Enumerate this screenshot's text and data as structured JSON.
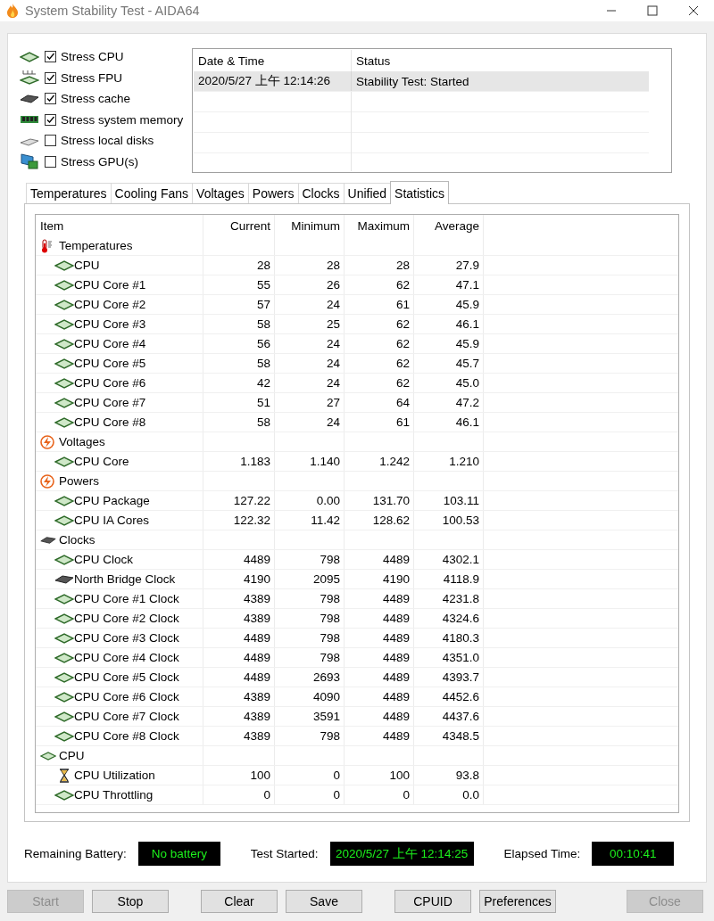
{
  "window": {
    "title": "System Stability Test - AIDA64"
  },
  "stress_options": [
    {
      "label": "Stress CPU",
      "checked": true,
      "kind": "cpu"
    },
    {
      "label": "Stress FPU",
      "checked": true,
      "kind": "fpu"
    },
    {
      "label": "Stress cache",
      "checked": true,
      "kind": "cache"
    },
    {
      "label": "Stress system memory",
      "checked": true,
      "kind": "memory"
    },
    {
      "label": "Stress local disks",
      "checked": false,
      "kind": "disk"
    },
    {
      "label": "Stress GPU(s)",
      "checked": false,
      "kind": "gpu"
    }
  ],
  "log": {
    "columns": [
      "Date & Time",
      "Status"
    ],
    "rows": [
      {
        "date_time": "2020/5/27 上午 12:14:26",
        "status": "Stability Test: Started",
        "selected": true
      }
    ]
  },
  "tabs": [
    {
      "label": "Temperatures",
      "selected": false
    },
    {
      "label": "Cooling Fans",
      "selected": false
    },
    {
      "label": "Voltages",
      "selected": false
    },
    {
      "label": "Powers",
      "selected": false
    },
    {
      "label": "Clocks",
      "selected": false
    },
    {
      "label": "Unified",
      "selected": false
    },
    {
      "label": "Statistics",
      "selected": true
    }
  ],
  "statistics": {
    "columns": [
      "Item",
      "Current",
      "Minimum",
      "Maximum",
      "Average"
    ],
    "groups": [
      {
        "label": "Temperatures",
        "kind": "thermometer",
        "children": [
          {
            "label": "CPU",
            "kind": "cpu",
            "values": [
              "28",
              "28",
              "28",
              "27.9"
            ]
          },
          {
            "label": "CPU Core #1",
            "kind": "cpu",
            "values": [
              "55",
              "26",
              "62",
              "47.1"
            ]
          },
          {
            "label": "CPU Core #2",
            "kind": "cpu",
            "values": [
              "57",
              "24",
              "61",
              "45.9"
            ]
          },
          {
            "label": "CPU Core #3",
            "kind": "cpu",
            "values": [
              "58",
              "25",
              "62",
              "46.1"
            ]
          },
          {
            "label": "CPU Core #4",
            "kind": "cpu",
            "values": [
              "56",
              "24",
              "62",
              "45.9"
            ]
          },
          {
            "label": "CPU Core #5",
            "kind": "cpu",
            "values": [
              "58",
              "24",
              "62",
              "45.7"
            ]
          },
          {
            "label": "CPU Core #6",
            "kind": "cpu",
            "values": [
              "42",
              "24",
              "62",
              "45.0"
            ]
          },
          {
            "label": "CPU Core #7",
            "kind": "cpu",
            "values": [
              "51",
              "27",
              "64",
              "47.2"
            ]
          },
          {
            "label": "CPU Core #8",
            "kind": "cpu",
            "values": [
              "58",
              "24",
              "61",
              "46.1"
            ]
          }
        ]
      },
      {
        "label": "Voltages",
        "kind": "bolt",
        "children": [
          {
            "label": "CPU Core",
            "kind": "cpu",
            "values": [
              "1.183",
              "1.140",
              "1.242",
              "1.210"
            ]
          }
        ]
      },
      {
        "label": "Powers",
        "kind": "bolt",
        "children": [
          {
            "label": "CPU Package",
            "kind": "cpu",
            "values": [
              "127.22",
              "0.00",
              "131.70",
              "103.11"
            ]
          },
          {
            "label": "CPU IA Cores",
            "kind": "cpu",
            "values": [
              "122.32",
              "11.42",
              "128.62",
              "100.53"
            ]
          }
        ]
      },
      {
        "label": "Clocks",
        "kind": "chip",
        "children": [
          {
            "label": "CPU Clock",
            "kind": "cpu",
            "values": [
              "4489",
              "798",
              "4489",
              "4302.1"
            ]
          },
          {
            "label": "North Bridge Clock",
            "kind": "chip",
            "values": [
              "4190",
              "2095",
              "4190",
              "4118.9"
            ]
          },
          {
            "label": "CPU Core #1 Clock",
            "kind": "cpu",
            "values": [
              "4389",
              "798",
              "4489",
              "4231.8"
            ]
          },
          {
            "label": "CPU Core #2 Clock",
            "kind": "cpu",
            "values": [
              "4389",
              "798",
              "4489",
              "4324.6"
            ]
          },
          {
            "label": "CPU Core #3 Clock",
            "kind": "cpu",
            "values": [
              "4489",
              "798",
              "4489",
              "4180.3"
            ]
          },
          {
            "label": "CPU Core #4 Clock",
            "kind": "cpu",
            "values": [
              "4489",
              "798",
              "4489",
              "4351.0"
            ]
          },
          {
            "label": "CPU Core #5 Clock",
            "kind": "cpu",
            "values": [
              "4489",
              "2693",
              "4489",
              "4393.7"
            ]
          },
          {
            "label": "CPU Core #6 Clock",
            "kind": "cpu",
            "values": [
              "4389",
              "4090",
              "4489",
              "4452.6"
            ]
          },
          {
            "label": "CPU Core #7 Clock",
            "kind": "cpu",
            "values": [
              "4389",
              "3591",
              "4489",
              "4437.6"
            ]
          },
          {
            "label": "CPU Core #8 Clock",
            "kind": "cpu",
            "values": [
              "4389",
              "798",
              "4489",
              "4348.5"
            ]
          }
        ]
      },
      {
        "label": "CPU",
        "kind": "cpu",
        "children": [
          {
            "label": "CPU Utilization",
            "kind": "hourglass",
            "values": [
              "100",
              "0",
              "100",
              "93.8"
            ]
          },
          {
            "label": "CPU Throttling",
            "kind": "cpu",
            "values": [
              "0",
              "0",
              "0",
              "0.0"
            ]
          }
        ]
      }
    ]
  },
  "status": [
    {
      "label": "Remaining Battery:",
      "value": "No battery"
    },
    {
      "label": "Test Started:",
      "value": "2020/5/27 上午 12:14:25"
    },
    {
      "label": "Elapsed Time:",
      "value": "00:10:41"
    }
  ],
  "button_groups": [
    [
      {
        "label": "Start",
        "disabled": true
      },
      {
        "label": "Stop",
        "disabled": false
      }
    ],
    [
      {
        "label": "Clear",
        "disabled": false
      },
      {
        "label": "Save",
        "disabled": false
      }
    ],
    [
      {
        "label": "CPUID",
        "disabled": false
      },
      {
        "label": "Preferences",
        "disabled": false
      }
    ],
    [
      {
        "label": "Close",
        "disabled": true
      }
    ]
  ]
}
